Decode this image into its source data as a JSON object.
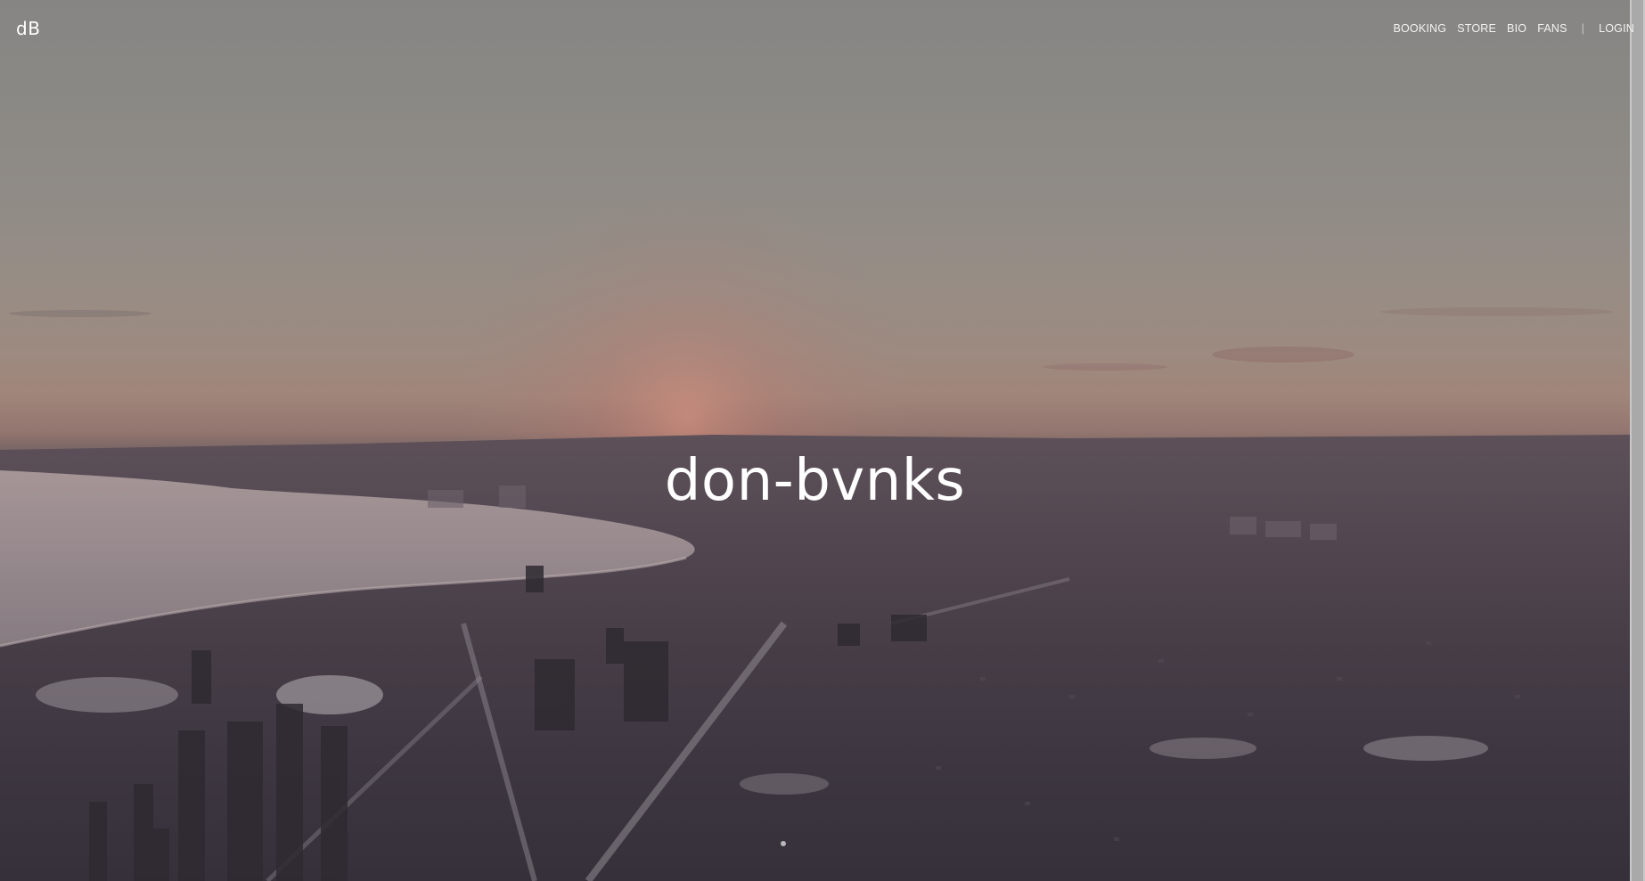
{
  "header": {
    "logo": "dB",
    "nav": {
      "booking": "BOOKING",
      "store": "STORE",
      "bio": "BIO",
      "fans": "FANS",
      "separator": "|",
      "login": "LOGIN"
    }
  },
  "hero": {
    "title": "don-bvnks",
    "background": "aerial-city-skyline-winter-sunset"
  },
  "colors": {
    "text": "#ffffff",
    "overlay": "#7f7d7b"
  }
}
